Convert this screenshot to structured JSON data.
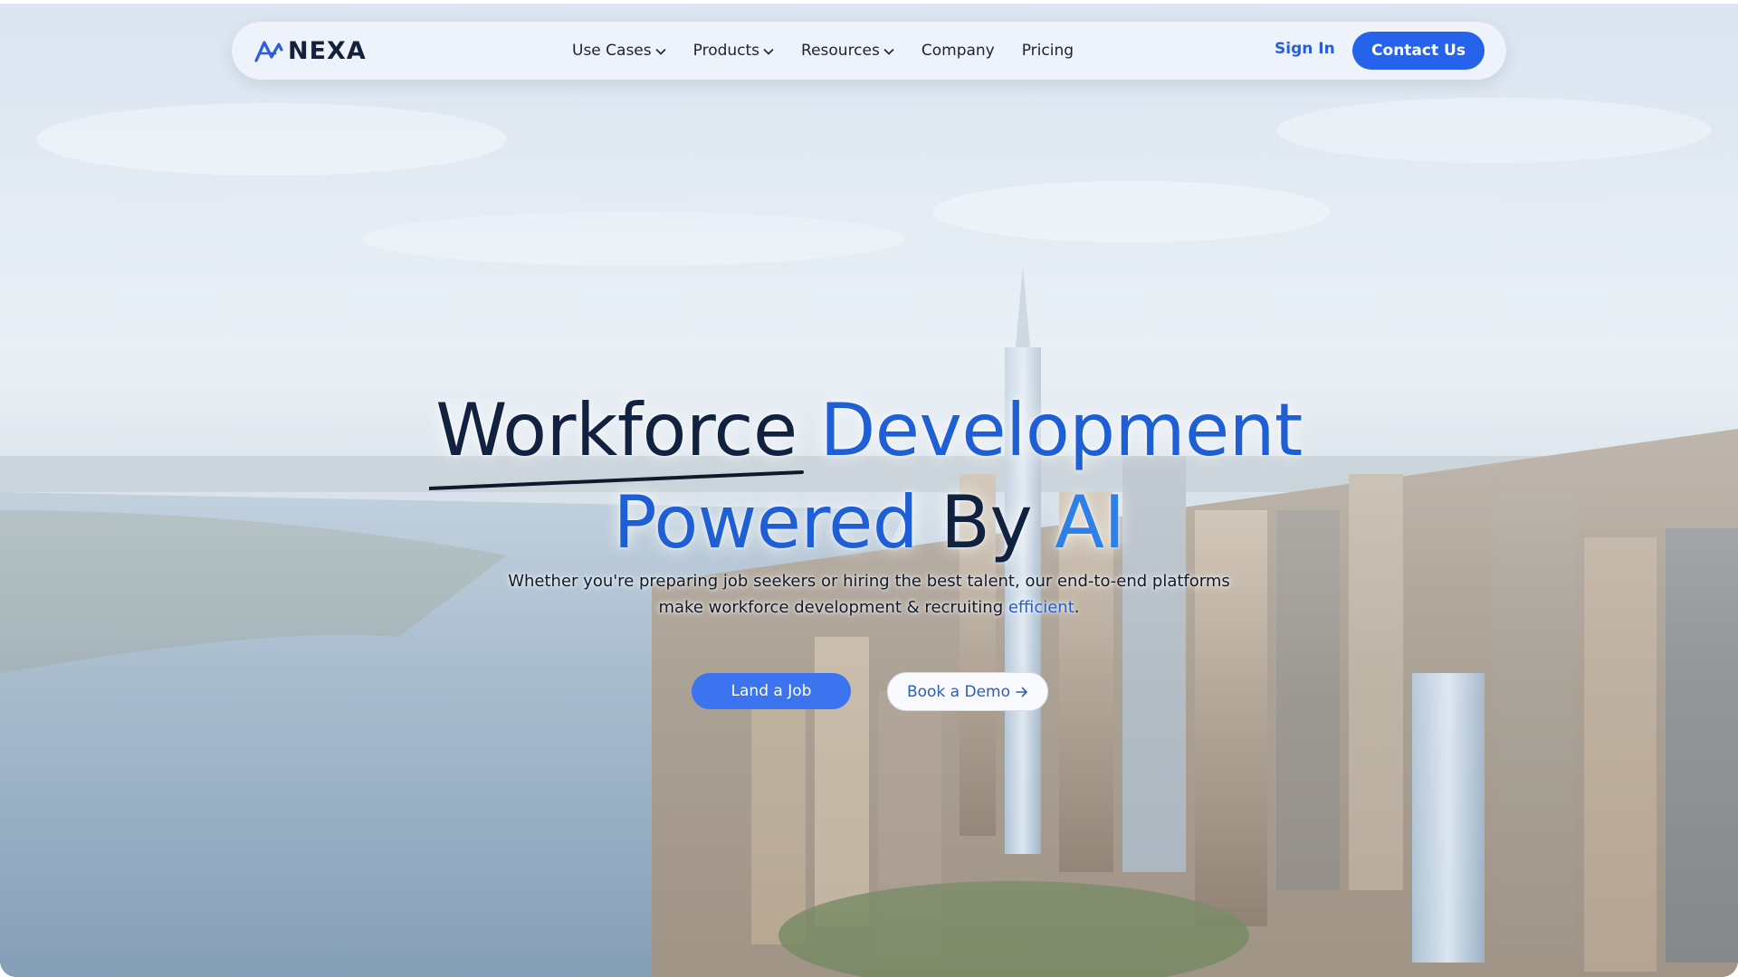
{
  "brand": {
    "name": "NEXA",
    "logo_icon": "nexa-logo-icon"
  },
  "nav": {
    "menu": [
      {
        "label": "Use Cases",
        "has_dropdown": true
      },
      {
        "label": "Products",
        "has_dropdown": true
      },
      {
        "label": "Resources",
        "has_dropdown": true
      },
      {
        "label": "Company",
        "has_dropdown": false
      },
      {
        "label": "Pricing",
        "has_dropdown": false
      }
    ],
    "sign_in": "Sign In",
    "contact": "Contact Us"
  },
  "hero": {
    "line1_a": "Workforce",
    "line1_b": "Development",
    "line2_a": "Powered",
    "line2_b": "By",
    "line2_c": "AI",
    "subtitle_line1": "Whether you're preparing job seekers or hiring the best talent, our end-to-end platforms",
    "subtitle_line2_a": "make workforce development & recruiting",
    "subtitle_accent": "efficient",
    "subtitle_end": ".",
    "cta_primary": "Land a Job",
    "cta_secondary": "Book a Demo",
    "background": "aerial-city-skyline-river-image"
  },
  "colors": {
    "accent": "#2563eb",
    "headline_dark": "#102240",
    "headline_blue": "#1f5fd6",
    "nav_bg": "#eef3fb"
  }
}
